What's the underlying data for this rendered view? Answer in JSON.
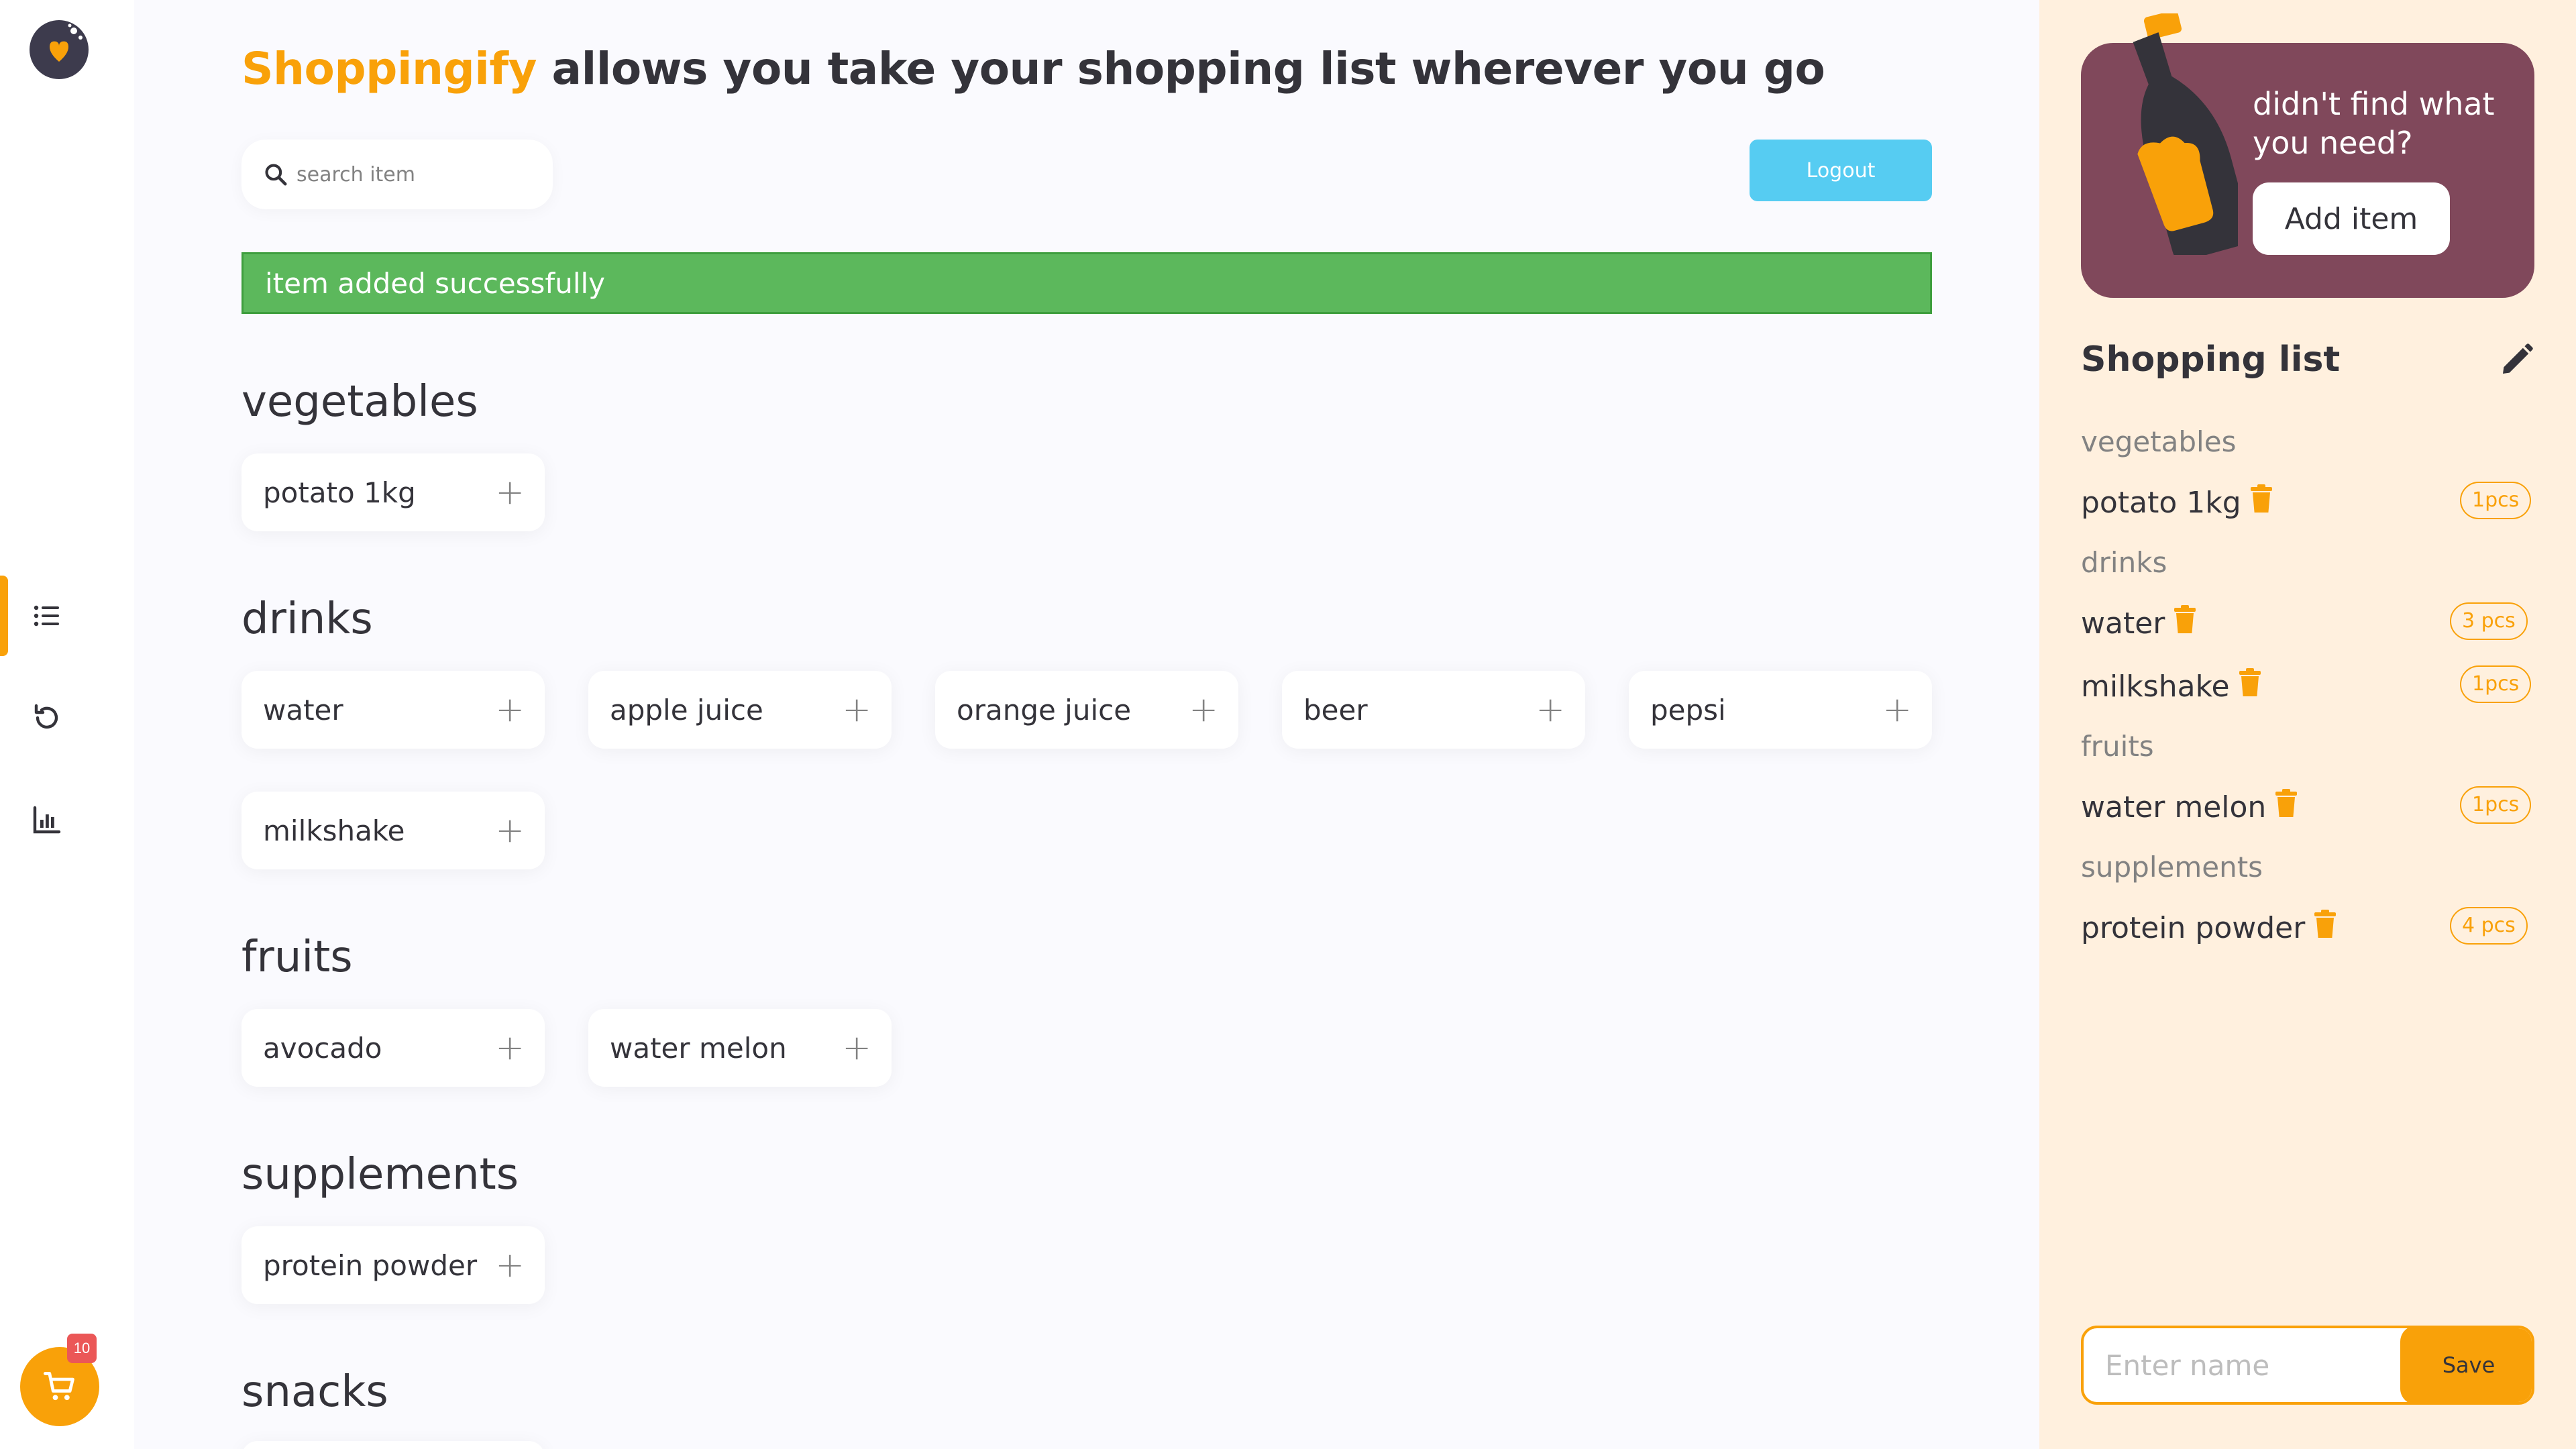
{
  "app": {
    "brand": "Shoppingify",
    "headline_rest": " allows you take your shopping list wherever you go"
  },
  "colors": {
    "accent": "#F9A109",
    "success": "#5CB85C",
    "logout": "#56CCF2",
    "promo": "#80485B",
    "panel": "#FFF0DE",
    "badge": "#EB5757"
  },
  "nav": {
    "items": [
      {
        "name": "items",
        "icon": "list-icon",
        "active": true
      },
      {
        "name": "history",
        "icon": "history-icon",
        "active": false
      },
      {
        "name": "statistics",
        "icon": "bar-chart-icon",
        "active": false
      }
    ],
    "cart_count": "10"
  },
  "search": {
    "placeholder": "search item",
    "value": ""
  },
  "logout_label": "Logout",
  "alert": "item added successfully",
  "categories": [
    {
      "title": "vegetables",
      "items": [
        "potato 1kg"
      ]
    },
    {
      "title": "drinks",
      "items": [
        "water",
        "apple juice",
        "orange juice",
        "beer",
        "pepsi",
        "milkshake"
      ]
    },
    {
      "title": "fruits",
      "items": [
        "avocado",
        "water melon"
      ]
    },
    {
      "title": "supplements",
      "items": [
        "protein powder"
      ]
    },
    {
      "title": "snacks",
      "items": []
    }
  ],
  "panel": {
    "promo_text": "didn't find what you need?",
    "promo_button": "Add item",
    "list_title": "Shopping list",
    "groups": [
      {
        "category": "vegetables",
        "items": [
          {
            "name": "potato 1kg",
            "qty": "1pcs"
          }
        ]
      },
      {
        "category": "drinks",
        "items": [
          {
            "name": "water",
            "qty": "3 pcs"
          },
          {
            "name": "milkshake",
            "qty": "1pcs"
          }
        ]
      },
      {
        "category": "fruits",
        "items": [
          {
            "name": "water melon",
            "qty": "1pcs"
          }
        ]
      },
      {
        "category": "supplements",
        "items": [
          {
            "name": "protein powder",
            "qty": "4 pcs"
          }
        ]
      }
    ],
    "name_placeholder": "Enter name",
    "save_label": "Save"
  }
}
